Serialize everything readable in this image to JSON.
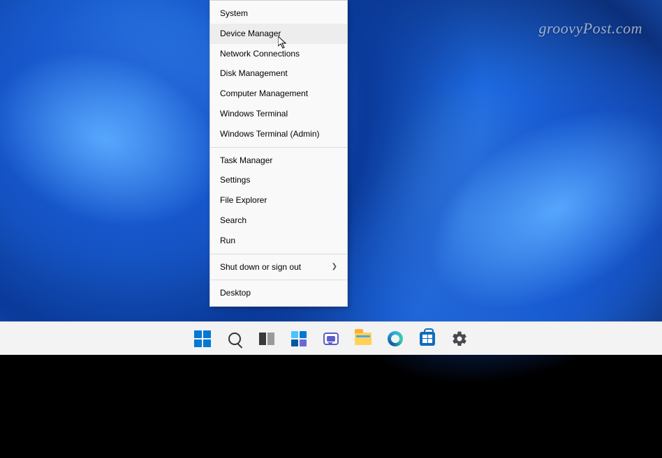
{
  "watermark": "groovyPost.com",
  "menu": {
    "items": [
      {
        "label": "System",
        "submenu": false,
        "hover": false
      },
      {
        "label": "Device Manager",
        "submenu": false,
        "hover": true
      },
      {
        "label": "Network Connections",
        "submenu": false,
        "hover": false
      },
      {
        "label": "Disk Management",
        "submenu": false,
        "hover": false
      },
      {
        "label": "Computer Management",
        "submenu": false,
        "hover": false
      },
      {
        "label": "Windows Terminal",
        "submenu": false,
        "hover": false
      },
      {
        "label": "Windows Terminal (Admin)",
        "submenu": false,
        "hover": false
      }
    ],
    "items2": [
      {
        "label": "Task Manager",
        "submenu": false,
        "hover": false
      },
      {
        "label": "Settings",
        "submenu": false,
        "hover": false
      },
      {
        "label": "File Explorer",
        "submenu": false,
        "hover": false
      },
      {
        "label": "Search",
        "submenu": false,
        "hover": false
      },
      {
        "label": "Run",
        "submenu": false,
        "hover": false
      }
    ],
    "items3": [
      {
        "label": "Shut down or sign out",
        "submenu": true,
        "hover": false
      }
    ],
    "items4": [
      {
        "label": "Desktop",
        "submenu": false,
        "hover": false
      }
    ]
  },
  "taskbar": {
    "start": "Start",
    "search": "Search",
    "taskview": "Task View",
    "widgets": "Widgets",
    "chat": "Chat",
    "explorer": "File Explorer",
    "edge": "Microsoft Edge",
    "store": "Microsoft Store",
    "settings": "Settings"
  }
}
